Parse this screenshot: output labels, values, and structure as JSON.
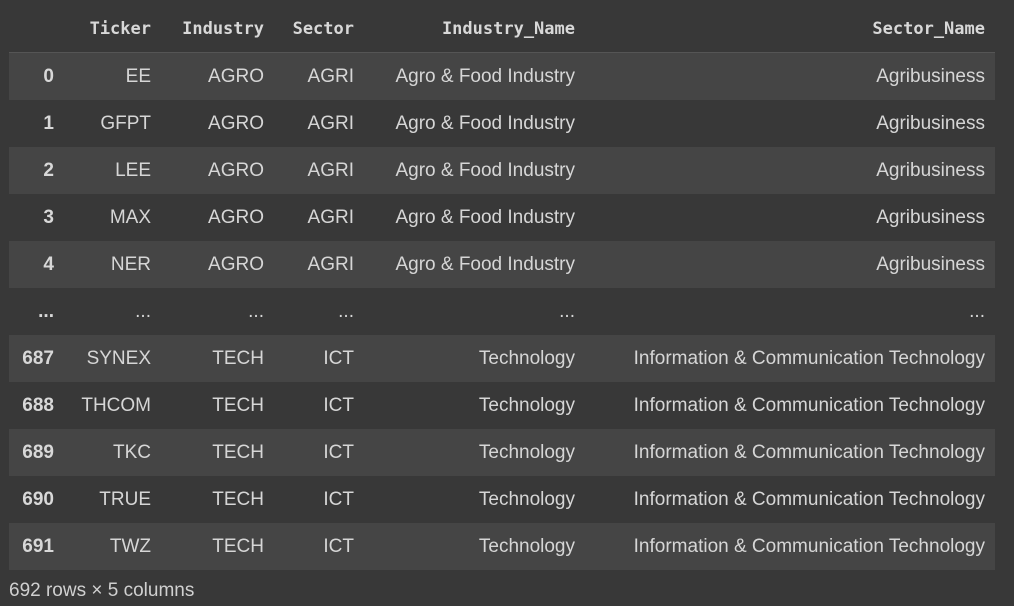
{
  "table": {
    "columns": [
      "",
      "Ticker",
      "Industry",
      "Sector",
      "Industry_Name",
      "Sector_Name"
    ],
    "rows": [
      {
        "index": "0",
        "cells": [
          "EE",
          "AGRO",
          "AGRI",
          "Agro & Food Industry",
          "Agribusiness"
        ]
      },
      {
        "index": "1",
        "cells": [
          "GFPT",
          "AGRO",
          "AGRI",
          "Agro & Food Industry",
          "Agribusiness"
        ]
      },
      {
        "index": "2",
        "cells": [
          "LEE",
          "AGRO",
          "AGRI",
          "Agro & Food Industry",
          "Agribusiness"
        ]
      },
      {
        "index": "3",
        "cells": [
          "MAX",
          "AGRO",
          "AGRI",
          "Agro & Food Industry",
          "Agribusiness"
        ]
      },
      {
        "index": "4",
        "cells": [
          "NER",
          "AGRO",
          "AGRI",
          "Agro & Food Industry",
          "Agribusiness"
        ]
      },
      {
        "index": "...",
        "cells": [
          "...",
          "...",
          "...",
          "...",
          "..."
        ]
      },
      {
        "index": "687",
        "cells": [
          "SYNEX",
          "TECH",
          "ICT",
          "Technology",
          "Information & Communication Technology"
        ]
      },
      {
        "index": "688",
        "cells": [
          "THCOM",
          "TECH",
          "ICT",
          "Technology",
          "Information & Communication Technology"
        ]
      },
      {
        "index": "689",
        "cells": [
          "TKC",
          "TECH",
          "ICT",
          "Technology",
          "Information & Communication Technology"
        ]
      },
      {
        "index": "690",
        "cells": [
          "TRUE",
          "TECH",
          "ICT",
          "Technology",
          "Information & Communication Technology"
        ]
      },
      {
        "index": "691",
        "cells": [
          "TWZ",
          "TECH",
          "ICT",
          "Technology",
          "Information & Communication Technology"
        ]
      }
    ]
  },
  "footer": "692 rows × 5 columns"
}
